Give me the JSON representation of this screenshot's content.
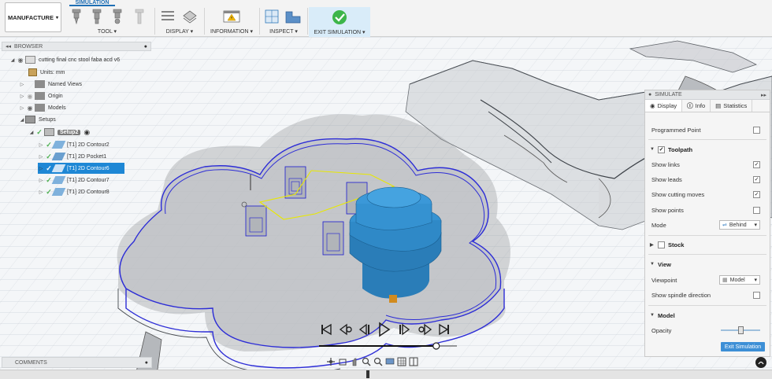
{
  "toolbar": {
    "workspace": "MANUFACTURE",
    "active_tab": "SIMULATION",
    "groups": [
      {
        "label": "TOOL ▾"
      },
      {
        "label": "DISPLAY ▾"
      },
      {
        "label": "INFORMATION ▾"
      },
      {
        "label": "INSPECT ▾"
      },
      {
        "label": "EXIT SIMULATION ▾"
      }
    ]
  },
  "browser": {
    "title": "BROWSER",
    "items": [
      {
        "label": "cutting final cnc stool faba acd v6"
      },
      {
        "label": "Units: mm"
      },
      {
        "label": "Named Views"
      },
      {
        "label": "Origin"
      },
      {
        "label": "Models"
      },
      {
        "label": "Setups"
      },
      {
        "label": "Setup2"
      },
      {
        "label": "[T1] 2D Contour2"
      },
      {
        "label": "[T1] 2D Pocket1"
      },
      {
        "label": "[T1] 2D Contour6"
      },
      {
        "label": "[T1] 2D Contour7"
      },
      {
        "label": "[T1] 2D Contour8"
      }
    ]
  },
  "comments": {
    "title": "COMMENTS"
  },
  "simulate": {
    "title": "SIMULATE",
    "tabs": [
      "Display",
      "Info",
      "Statistics"
    ],
    "programmed_point": {
      "label": "Programmed Point",
      "checked": false
    },
    "toolpath": {
      "title": "Toolpath",
      "checked": true,
      "show_links": {
        "label": "Show links",
        "checked": true
      },
      "show_leads": {
        "label": "Show leads",
        "checked": true
      },
      "show_cutting_moves": {
        "label": "Show cutting moves",
        "checked": true
      },
      "show_points": {
        "label": "Show points",
        "checked": false
      },
      "mode_label": "Mode",
      "mode_value": "Behind"
    },
    "stock": {
      "title": "Stock",
      "checked": false
    },
    "view": {
      "title": "View",
      "viewpoint_label": "Viewpoint",
      "viewpoint_value": "Model",
      "spindle_label": "Show spindle direction",
      "spindle_checked": false
    },
    "model": {
      "title": "Model",
      "opacity_label": "Opacity",
      "opacity_value": 0.5
    },
    "exit_button": "Exit Simulation"
  },
  "playback": {
    "progress": 0.85,
    "icons": [
      "skip-start-icon",
      "step-back-icon",
      "prev-icon",
      "play-icon",
      "next-icon",
      "step-forward-icon",
      "skip-end-icon"
    ]
  },
  "colors": {
    "accent": "#1e87d5",
    "exit_check": "#3cb54a",
    "tool_body": "#2a7db8",
    "toolpath_link": "#e8e800",
    "toolpath_cut": "#1a1ad0"
  }
}
